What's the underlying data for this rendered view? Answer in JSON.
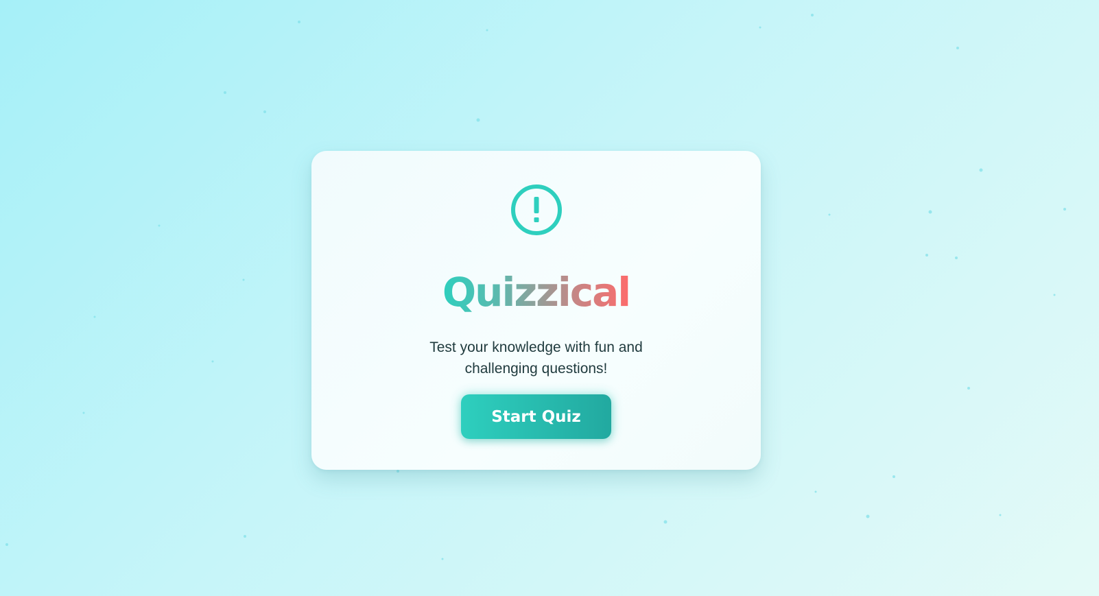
{
  "app": {
    "title": "Quizzical",
    "subtitle": "Test your knowledge with fun and challenging questions!",
    "start_button_label": "Start Quiz",
    "icon": "alert-circle-icon"
  },
  "colors": {
    "accent": "#2ecfbe",
    "accent_dark": "#22a9a0",
    "title_gradient_end": "#fd6b6b",
    "text": "#1f3a3d",
    "background_start": "#a6f0f8",
    "background_end": "#e4faf7"
  }
}
